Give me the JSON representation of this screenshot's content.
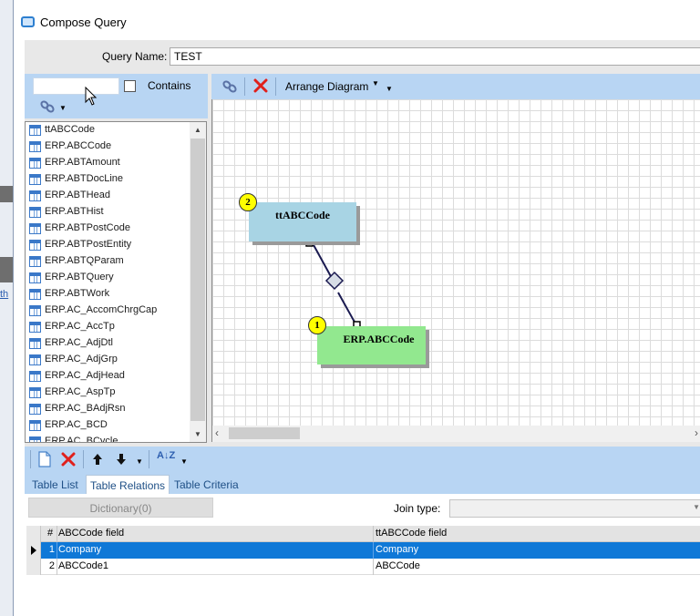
{
  "window": {
    "title": "Compose Query"
  },
  "background": {
    "link_text": "th"
  },
  "query": {
    "name_label": "Query Name:",
    "name_value": "TEST"
  },
  "left_panel": {
    "search_value": "",
    "contains_label": "Contains",
    "contains_checked": false,
    "tables": [
      "ttABCCode",
      "ERP.ABCCode",
      "ERP.ABTAmount",
      "ERP.ABTDocLine",
      "ERP.ABTHead",
      "ERP.ABTHist",
      "ERP.ABTPostCode",
      "ERP.ABTPostEntity",
      "ERP.ABTQParam",
      "ERP.ABTQuery",
      "ERP.ABTWork",
      "ERP.AC_AccomChrgCap",
      "ERP.AC_AccTp",
      "ERP.AC_AdjDtl",
      "ERP.AC_AdjGrp",
      "ERP.AC_AdjHead",
      "ERP.AC_AspTp",
      "ERP.AC_BAdjRsn",
      "ERP.AC_BCD",
      "ERP.AC_BCycle"
    ]
  },
  "diagram_toolbar": {
    "arrange_label": "Arrange Diagram"
  },
  "diagram": {
    "nodes": [
      {
        "label": "ttABCCode",
        "badge": "2",
        "color": "#a8d4e4"
      },
      {
        "label": "ERP.ABCCode",
        "badge": "1",
        "color": "#92e88f"
      }
    ]
  },
  "bottom_toolbar": {
    "sort_label": "A↓Z"
  },
  "tabs": [
    {
      "label": "Table List",
      "active": false
    },
    {
      "label": "Table Relations",
      "active": true
    },
    {
      "label": "Table Criteria",
      "active": false
    }
  ],
  "relations": {
    "dictionary_button": "Dictionary(0)",
    "join_type_label": "Join type:",
    "join_type_value": "",
    "columns": [
      "#",
      "ABCCode field",
      "ttABCCode field"
    ],
    "rows": [
      {
        "num": "1",
        "field": "Company",
        "tt_field": "Company",
        "selected": true
      },
      {
        "num": "2",
        "field": "ABCCode1",
        "tt_field": "ABCCode",
        "selected": false
      }
    ]
  },
  "colors": {
    "toolbar_blue": "#b8d5f3",
    "selection_blue": "#0f78d7",
    "delete_red": "#e0201c"
  }
}
